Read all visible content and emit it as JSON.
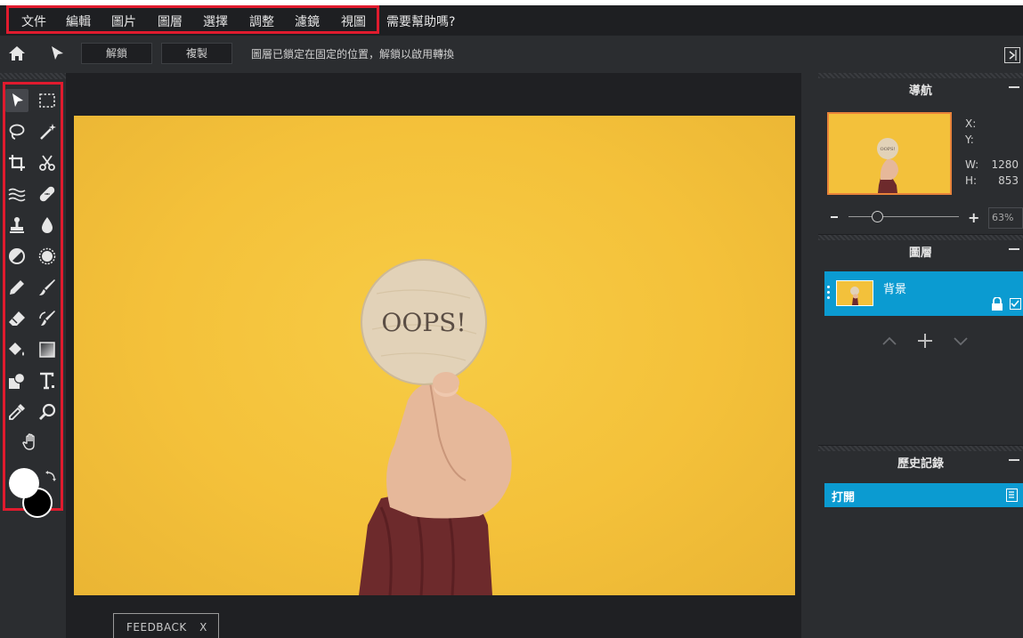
{
  "menubar": {
    "items": [
      "文件",
      "編輯",
      "圖片",
      "圖層",
      "選擇",
      "調整",
      "濾鏡",
      "視圖"
    ],
    "help": "需要幫助嗎?"
  },
  "options_bar": {
    "unlock_label": "解鎖",
    "duplicate_label": "複製",
    "info": "圖層已鎖定在固定的位置，解鎖以啟用轉換"
  },
  "tools": [
    "move-tool",
    "marquee-tool",
    "lasso-tool",
    "magic-wand-tool",
    "crop-tool",
    "scissors-tool",
    "liquify-tool",
    "healing-tool",
    "clone-stamp-tool",
    "blur-tool",
    "dodge-burn-tool",
    "sponge-tool",
    "pencil-tool",
    "brush-tool",
    "eraser-tool",
    "color-replace-tool",
    "paint-bucket-tool",
    "gradient-tool",
    "shape-tool",
    "text-tool",
    "eyedropper-tool",
    "zoom-tool",
    "hand-tool"
  ],
  "colors": {
    "foreground": "#ffffff",
    "background": "#000000",
    "accent": "#0b9bd1",
    "highlight": "#e01b2e"
  },
  "canvas": {
    "image_text": "OOPS!",
    "feedback_label": "FEEDBACK",
    "feedback_close": "X"
  },
  "navigator": {
    "title": "導航",
    "x_label": "X:",
    "y_label": "Y:",
    "w_label": "W:",
    "w_value": "1280",
    "h_label": "H:",
    "h_value": "853",
    "zoom_value": "63%",
    "zoom_level": 0.63
  },
  "layers": {
    "title": "圖層",
    "items": [
      {
        "name": "背景",
        "locked": true,
        "visible": true
      }
    ]
  },
  "history": {
    "title": "歷史記錄",
    "items": [
      "打開"
    ]
  }
}
